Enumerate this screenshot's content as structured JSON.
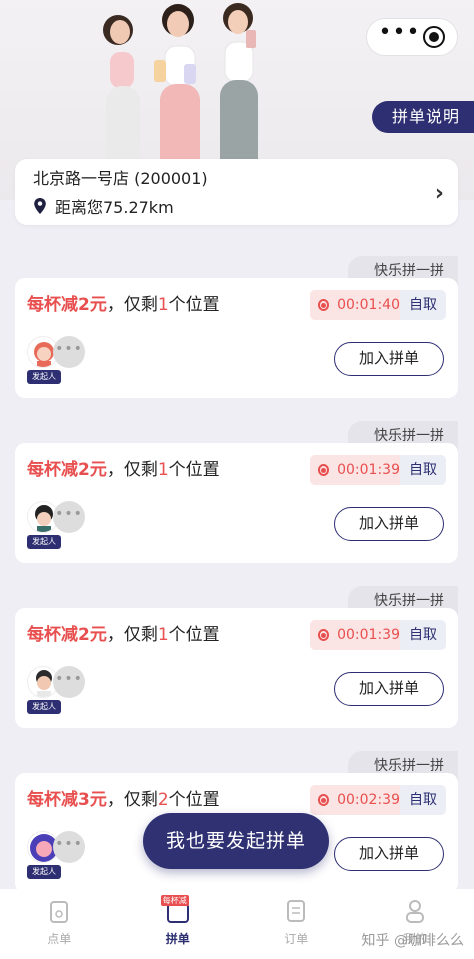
{
  "header": {
    "explain_label": "拼单说明",
    "capsule_dots": "•••"
  },
  "store": {
    "name": "北京路一号店 (200001)",
    "distance": "距离您75.27km"
  },
  "groups": [
    {
      "tag": "快乐拼一拼",
      "title_prefix": "每杯减2元",
      "title_mid": "，仅剩",
      "count": "1",
      "title_suffix": "个位置",
      "timer": "00:01:40",
      "pickup": "自取",
      "host": "发起人",
      "join": "加入拼单"
    },
    {
      "tag": "快乐拼一拼",
      "title_prefix": "每杯减2元",
      "title_mid": "，仅剩",
      "count": "1",
      "title_suffix": "个位置",
      "timer": "00:01:39",
      "pickup": "自取",
      "host": "发起人",
      "join": "加入拼单"
    },
    {
      "tag": "快乐拼一拼",
      "title_prefix": "每杯减2元",
      "title_mid": "，仅剩",
      "count": "1",
      "title_suffix": "个位置",
      "timer": "00:01:39",
      "pickup": "自取",
      "host": "发起人",
      "join": "加入拼单"
    },
    {
      "tag": "快乐拼一拼",
      "title_prefix": "每杯减3元",
      "title_mid": "，仅剩",
      "count": "2",
      "title_suffix": "个位置",
      "timer": "00:02:39",
      "pickup": "自取",
      "host": "发起人",
      "join": "加入拼单"
    }
  ],
  "cta": {
    "label": "我也要发起拼单"
  },
  "tabbar": {
    "items": [
      {
        "label": "点单"
      },
      {
        "label": "拼单",
        "badge": "每杯减"
      },
      {
        "label": "订单"
      },
      {
        "label": "我的"
      }
    ]
  },
  "watermark": "知乎 @咖啡么么",
  "colors": {
    "primary": "#2e2f72",
    "accent_red": "#e84f4f",
    "background": "#eeeef4"
  }
}
